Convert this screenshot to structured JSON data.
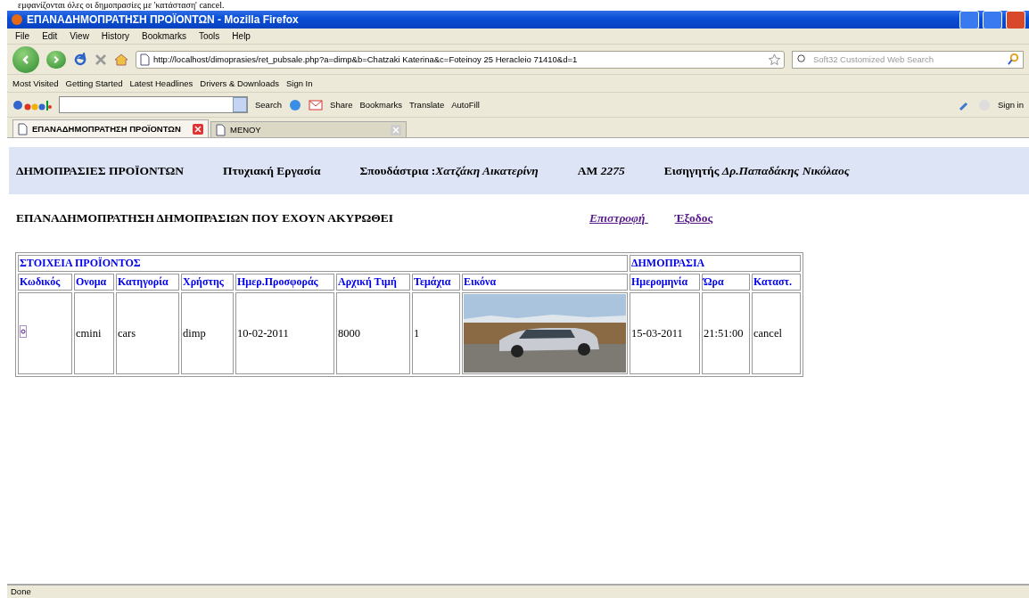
{
  "document_caption": "εμφανίζονται όλες οι δημοπρασίες με 'κατάσταση' cancel.",
  "window": {
    "title": "ΕΠΑΝΑΔΗΜΟΠΡΑΤΗΣΗ ΠΡΟΪΟΝΤΩΝ - Mozilla Firefox"
  },
  "menu": [
    "File",
    "Edit",
    "View",
    "History",
    "Bookmarks",
    "Tools",
    "Help"
  ],
  "address": {
    "value": "http://localhost/dimoprasies/ret_pubsale.php?a=dimp&b=Chatzaki Katerina&c=Foteinoy 25 Heracleio 71410&d=1"
  },
  "search": {
    "placeholder": "Soft32 Customized Web Search"
  },
  "bookmarks": [
    "Most Visited",
    "Getting Started",
    "Latest Headlines",
    "Drivers & Downloads",
    "Sign In"
  ],
  "google_toolbar": {
    "search": "Search",
    "share": "Share",
    "bookmarks": "Bookmarks",
    "translate": "Translate",
    "autofill": "AutoFill",
    "sign_in": "Sign in"
  },
  "tabs": [
    {
      "label": "ΕΠΑΝΑΔΗΜΟΠΡΑΤΗΣΗ ΠΡΟΪΟΝΤΩΝ",
      "selected": true
    },
    {
      "label": "ΜΕΝΟΥ",
      "selected": false
    }
  ],
  "page": {
    "header": [
      "ΔΗΜΟΠΡΑΣΙΕΣ ΠΡΟΪΟΝΤΩΝ",
      "Πτυχιακή Εργασία",
      "Σπουδάστρια :*Χατζάκη Αικατερίνη*",
      "ΑΜ *2275*",
      "Εισηγητής *Δρ.Παπαδάκης Νικόλαος*"
    ],
    "title": "ΕΠΑΝΑΔΗΜΟΠΡΑΤΗΣΗ ΔΗΜΟΠΡΑΣΙΩΝ ΠΟΥ ΕΧΟΥΝ ΑΚΥΡΩΘΕΙ",
    "links": [
      "Επιστροφή ",
      "Έξοδος"
    ],
    "table": {
      "groups": [
        {
          "title": "ΣΤΟΙΧΕΙΑ ΠΡΟΪΟΝΤΟΣ",
          "columns": [
            "Κωδικός",
            "Ονομα",
            "Κατηγορία",
            "Χρήστης",
            "Ημερ.Προσφοράς",
            "Αρχική Τιμή",
            "Τεμάχια",
            "Εικόνα"
          ]
        },
        {
          "title": "ΔΗΜΟΠΡΑΣΙΑ",
          "columns": [
            "Ημερομηνία",
            "Ώρα",
            "Καταστ."
          ]
        }
      ],
      "rows": [
        {
          "cells": [
            {
              "kind": "link-icon"
            },
            {
              "kind": "text",
              "text": "cmini"
            },
            {
              "kind": "text",
              "text": "cars"
            },
            {
              "kind": "text",
              "text": "dimp"
            },
            {
              "kind": "text",
              "text": "10-02-2011"
            },
            {
              "kind": "text",
              "text": "8000"
            },
            {
              "kind": "text",
              "text": "1"
            },
            {
              "kind": "picture"
            },
            {
              "kind": "text",
              "text": "15-03-2011"
            },
            {
              "kind": "text",
              "text": "21:51:00"
            },
            {
              "kind": "text",
              "text": "cancel"
            }
          ]
        }
      ]
    }
  },
  "status_bar": "Done"
}
